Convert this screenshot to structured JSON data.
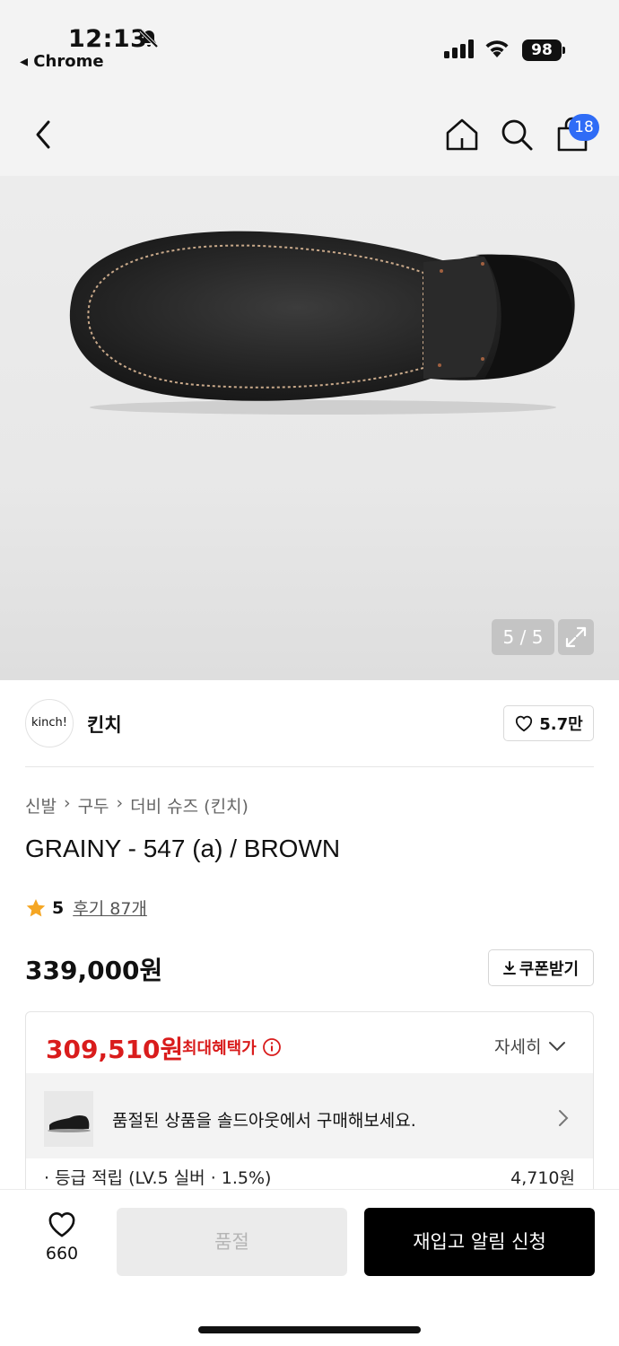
{
  "status_bar": {
    "time": "12:13",
    "back_app": "◂ Chrome",
    "battery": "98",
    "icons": [
      "bell-slash-icon",
      "signal-icon",
      "wifi-icon",
      "battery-icon"
    ]
  },
  "nav": {
    "cart_badge": "18",
    "icons": [
      "back-chevron-icon",
      "home-icon",
      "search-icon",
      "shopping-bag-icon"
    ]
  },
  "gallery": {
    "counter": "5 / 5",
    "expand_icon": "expand-icon"
  },
  "brand": {
    "logo_text": "kinch!",
    "name": "킨치",
    "likes": "5.7만"
  },
  "breadcrumb": [
    "신발",
    "구두",
    "더비 슈즈 (킨치)"
  ],
  "product": {
    "title": "GRAINY - 547 (a) / BROWN",
    "rating": "5",
    "reviews": "후기 87개",
    "price": "339,000원",
    "coupon_label": "쿠폰받기"
  },
  "benefit": {
    "max_price": "309,510원",
    "max_label": "최대혜택가",
    "detail_label": "자세히",
    "soldout_text": "품절된 상품을 솔드아웃에서 구매해보세요.",
    "point_label": "· 등급 적립 (LV.5 실버 · 1.5%)",
    "point_value": "4,710원",
    "accent_color": "#d91c1c"
  },
  "bottom": {
    "wish_count": "660",
    "soldout_button": "품절",
    "restock_button": "재입고 알림 신청"
  },
  "colors": {
    "badge": "#2f6cf6",
    "star": "#f5a623"
  }
}
